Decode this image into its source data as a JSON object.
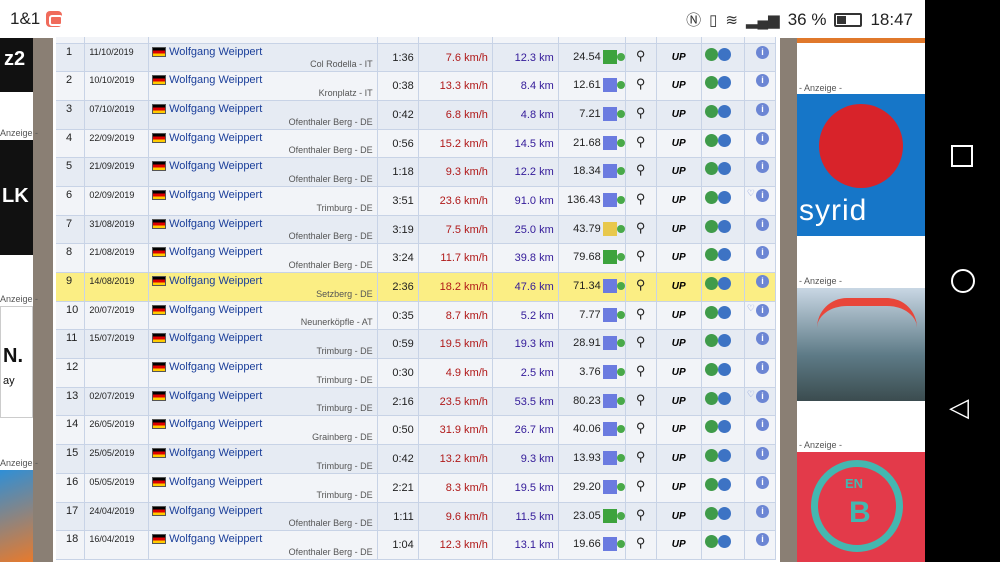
{
  "status": {
    "carrier": "1&1",
    "battery_pct": "36 %",
    "time": "18:47"
  },
  "left_ads": {
    "label": "Anzeige -",
    "logo_fragment_1": "z2",
    "logo_fragment_2": "LK",
    "logo_fragment_3": "N.",
    "logo_fragment_4": "ay"
  },
  "right_ads": {
    "label": "- Anzeige -",
    "ad2_text": "syrid",
    "ad4_text": "EN",
    "ad4_letter": "B"
  },
  "flights": [
    {
      "no": "1",
      "date": "11/10/2019",
      "pilot": "Wolfgang Weippert",
      "site": "Col Rodella - IT",
      "dur": "1:36",
      "speed": "7.6 km/h",
      "dist": "12.3 km",
      "pts": "24.54",
      "type": "tri",
      "comment": false
    },
    {
      "no": "2",
      "date": "10/10/2019",
      "pilot": "Wolfgang Weippert",
      "site": "Kronplatz - IT",
      "dur": "0:38",
      "speed": "13.3 km/h",
      "dist": "8.4 km",
      "pts": "12.61",
      "type": "free",
      "comment": false
    },
    {
      "no": "3",
      "date": "07/10/2019",
      "pilot": "Wolfgang Weippert",
      "site": "Ofenthaler Berg - DE",
      "dur": "0:42",
      "speed": "6.8 km/h",
      "dist": "4.8 km",
      "pts": "7.21",
      "type": "free",
      "comment": false
    },
    {
      "no": "4",
      "date": "22/09/2019",
      "pilot": "Wolfgang Weippert",
      "site": "Ofenthaler Berg - DE",
      "dur": "0:56",
      "speed": "15.2 km/h",
      "dist": "14.5 km",
      "pts": "21.68",
      "type": "free",
      "comment": false
    },
    {
      "no": "5",
      "date": "21/09/2019",
      "pilot": "Wolfgang Weippert",
      "site": "Ofenthaler Berg - DE",
      "dur": "1:18",
      "speed": "9.3 km/h",
      "dist": "12.2 km",
      "pts": "18.34",
      "type": "free",
      "comment": false
    },
    {
      "no": "6",
      "date": "02/09/2019",
      "pilot": "Wolfgang Weippert",
      "site": "Trimburg - DE",
      "dur": "3:51",
      "speed": "23.6 km/h",
      "dist": "91.0 km",
      "pts": "136.43",
      "type": "free",
      "comment": true
    },
    {
      "no": "7",
      "date": "31/08/2019",
      "pilot": "Wolfgang Weippert",
      "site": "Ofenthaler Berg - DE",
      "dur": "3:19",
      "speed": "7.5 km/h",
      "dist": "25.0 km",
      "pts": "43.79",
      "type": "mixed",
      "comment": false
    },
    {
      "no": "8",
      "date": "21/08/2019",
      "pilot": "Wolfgang Weippert",
      "site": "Ofenthaler Berg - DE",
      "dur": "3:24",
      "speed": "11.7 km/h",
      "dist": "39.8 km",
      "pts": "79.68",
      "type": "tri",
      "comment": false
    },
    {
      "no": "9",
      "date": "14/08/2019",
      "pilot": "Wolfgang Weippert",
      "site": "Setzberg - DE",
      "dur": "2:36",
      "speed": "18.2 km/h",
      "dist": "47.6 km",
      "pts": "71.34",
      "type": "free",
      "comment": false,
      "hl": true
    },
    {
      "no": "10",
      "date": "20/07/2019",
      "pilot": "Wolfgang Weippert",
      "site": "Neunerköpfle - AT",
      "dur": "0:35",
      "speed": "8.7 km/h",
      "dist": "5.2 km",
      "pts": "7.77",
      "type": "free",
      "comment": true
    },
    {
      "no": "11",
      "date": "15/07/2019",
      "pilot": "Wolfgang Weippert",
      "site": "Trimburg - DE",
      "dur": "0:59",
      "speed": "19.5 km/h",
      "dist": "19.3 km",
      "pts": "28.91",
      "type": "free",
      "comment": false
    },
    {
      "no": "12",
      "date": "",
      "pilot": "Wolfgang Weippert",
      "site": "Trimburg - DE",
      "dur": "0:30",
      "speed": "4.9 km/h",
      "dist": "2.5 km",
      "pts": "3.76",
      "type": "free",
      "comment": false
    },
    {
      "no": "13",
      "date": "02/07/2019",
      "pilot": "Wolfgang Weippert",
      "site": "Trimburg - DE",
      "dur": "2:16",
      "speed": "23.5 km/h",
      "dist": "53.5 km",
      "pts": "80.23",
      "type": "free",
      "comment": true
    },
    {
      "no": "14",
      "date": "26/05/2019",
      "pilot": "Wolfgang Weippert",
      "site": "Grainberg - DE",
      "dur": "0:50",
      "speed": "31.9 km/h",
      "dist": "26.7 km",
      "pts": "40.06",
      "type": "free",
      "comment": false
    },
    {
      "no": "15",
      "date": "25/05/2019",
      "pilot": "Wolfgang Weippert",
      "site": "Trimburg - DE",
      "dur": "0:42",
      "speed": "13.2 km/h",
      "dist": "9.3 km",
      "pts": "13.93",
      "type": "free",
      "comment": false
    },
    {
      "no": "16",
      "date": "05/05/2019",
      "pilot": "Wolfgang Weippert",
      "site": "Trimburg - DE",
      "dur": "2:21",
      "speed": "8.3 km/h",
      "dist": "19.5 km",
      "pts": "29.20",
      "type": "free",
      "comment": false
    },
    {
      "no": "17",
      "date": "24/04/2019",
      "pilot": "Wolfgang Weippert",
      "site": "Ofenthaler Berg - DE",
      "dur": "1:11",
      "speed": "9.6 km/h",
      "dist": "11.5 km",
      "pts": "23.05",
      "type": "tri",
      "comment": false
    },
    {
      "no": "18",
      "date": "16/04/2019",
      "pilot": "Wolfgang Weippert",
      "site": "Ofenthaler Berg - DE",
      "dur": "1:04",
      "speed": "12.3 km/h",
      "dist": "13.1 km",
      "pts": "19.66",
      "type": "free",
      "comment": false
    }
  ],
  "brand_label": "UP",
  "info_label": "i"
}
